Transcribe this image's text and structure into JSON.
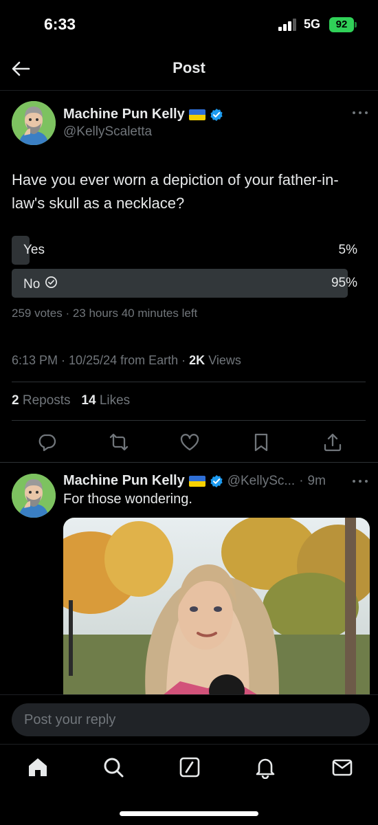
{
  "status_bar": {
    "time": "6:33",
    "network": "5G",
    "battery": "92"
  },
  "header": {
    "title": "Post"
  },
  "post": {
    "author_name": "Machine Pun Kelly",
    "handle": "@KellyScaletta",
    "text": "Have you ever worn a depiction of your father-in-law's skull as a necklace?",
    "poll": {
      "options": [
        {
          "label": "Yes",
          "percent_label": "5%",
          "percent": 5,
          "selected": false
        },
        {
          "label": "No",
          "percent_label": "95%",
          "percent": 95,
          "selected": true
        }
      ],
      "votes": "259 votes",
      "time_left": "23 hours 40 minutes left"
    },
    "time": "6:13 PM",
    "date": "10/25/24",
    "source": "from Earth",
    "views_count": "2K",
    "views_label": "Views",
    "reposts_count": "2",
    "reposts_label": "Reposts",
    "likes_count": "14",
    "likes_label": "Likes"
  },
  "reply": {
    "author_name": "Machine Pun Kelly",
    "handle": "@KellySc...",
    "time_ago": "9m",
    "text": "For those wondering."
  },
  "reply_bar": {
    "placeholder": "Post your reply"
  },
  "tabs": [
    "home-icon",
    "search-icon",
    "grok-icon",
    "notifications-icon",
    "messages-icon"
  ],
  "colors": {
    "accent": "#1d9bf0",
    "background": "#000000",
    "muted": "#71767b",
    "poll_bar": "#2f3336",
    "battery": "#30d158"
  }
}
